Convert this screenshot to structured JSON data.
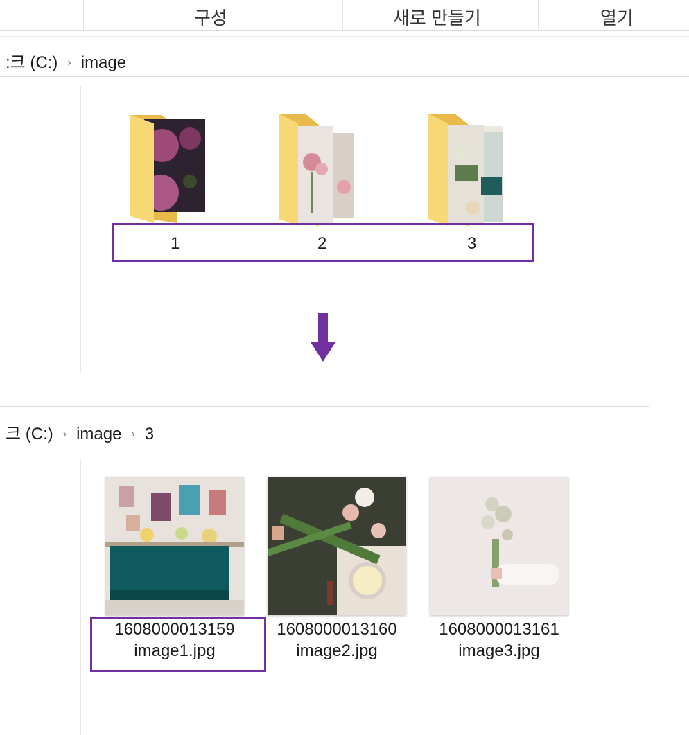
{
  "ribbon": {
    "groups": [
      {
        "label": "구성"
      },
      {
        "label": "새로 만들기"
      },
      {
        "label": "열기"
      }
    ]
  },
  "top_window": {
    "breadcrumb": [
      {
        "label": ":크 (C:)"
      },
      {
        "label": "image"
      }
    ],
    "folders": [
      {
        "name": "1"
      },
      {
        "name": "2"
      },
      {
        "name": "3"
      }
    ]
  },
  "bottom_window": {
    "breadcrumb": [
      {
        "label": "크 (C:)"
      },
      {
        "label": "image"
      },
      {
        "label": "3"
      }
    ],
    "files": [
      {
        "line1": "1608000013159",
        "line2": "image1.jpg"
      },
      {
        "line1": "1608000013160",
        "line2": "image2.jpg"
      },
      {
        "line1": "1608000013161",
        "line2": "image3.jpg"
      }
    ]
  },
  "colors": {
    "highlight": "#7030a0",
    "folder": "#f8d775",
    "arrow": "#7030a0"
  },
  "icons": {
    "breadcrumb_separator": "chevron-right-icon",
    "folder": "folder-icon",
    "arrow": "arrow-down-icon"
  }
}
